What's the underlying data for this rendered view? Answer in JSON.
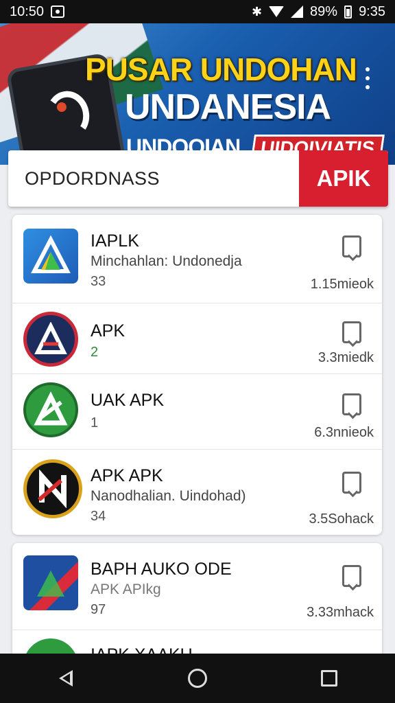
{
  "status_bar": {
    "time": "10:50",
    "battery_percent": "89%",
    "clock_right": "9:35",
    "icons": [
      "app-notification-icon",
      "bluetooth-icon",
      "wifi-icon",
      "signal-icon",
      "battery-icon"
    ]
  },
  "banner": {
    "title_line1": "PUSAR UNDOHAN",
    "title_line2": "UNDANESIA",
    "subtitle_left": "UNDOOIAN",
    "subtitle_right": "UIDOIVIATIS",
    "colors": {
      "title_yellow": "#ffd21a",
      "badge_red": "#d2222a",
      "bg_blue": "#1a5fb0"
    }
  },
  "search": {
    "placeholder": "OPDORDNASS",
    "button_label": "APIK",
    "button_color": "#d71f30"
  },
  "apps": [
    {
      "title": "IAPLK",
      "subtitle": "Minchahlan: Undonedja",
      "number": "33",
      "size": "1.15mieok",
      "icon": "blue-triangle-app-icon"
    },
    {
      "title": "APK",
      "subtitle": "",
      "number": "2",
      "size": "3.3miedk",
      "icon": "red-ring-app-icon"
    },
    {
      "title": "UAK APK",
      "subtitle": "",
      "number": "1",
      "size": "6.3nnieok",
      "icon": "green-a-app-icon"
    },
    {
      "title": "APK APK",
      "subtitle": "Nanodhalian. Uindohad)",
      "number": "34",
      "size": "3.5Sohack",
      "icon": "black-n-app-icon"
    },
    {
      "title": "BAPH AUKO ODE",
      "subtitle": "APK APIkg",
      "number": "97",
      "size": "3.33mhack",
      "icon": "striped-app-icon"
    },
    {
      "title": "IAPK XAAKU",
      "subtitle": "",
      "number": "",
      "size": "",
      "icon": "green-partial-app-icon"
    }
  ],
  "nav": {
    "buttons": [
      "back-icon",
      "home-icon",
      "recent-apps-icon"
    ]
  }
}
